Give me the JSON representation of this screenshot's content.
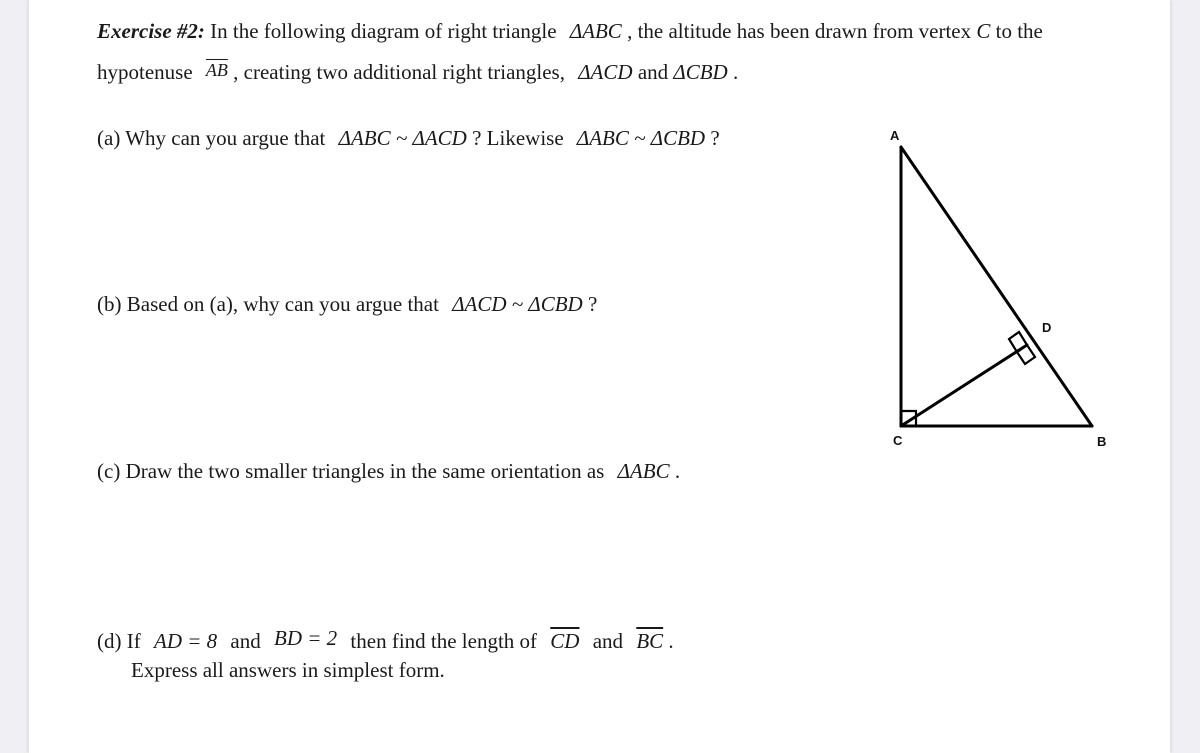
{
  "exercise": {
    "heading": "Exercise #2:",
    "intro_line1": {
      "t1": "In the following diagram of right triangle",
      "tri": "ΔABC",
      "t2": ", the altitude has been drawn from vertex",
      "vertex": "C",
      "t3": "to the"
    },
    "intro_line2": {
      "t1": "hypotenuse",
      "seg": "AB",
      "t2": ", creating two additional right triangles,",
      "tri1": "ΔACD",
      "and": "and",
      "tri2": "ΔCBD",
      "end": "."
    }
  },
  "parts": {
    "a": {
      "label": "(a)",
      "t1": "Why can you argue that",
      "sim1": "ΔABC ~ ΔACD",
      "t2": "? Likewise",
      "sim2": "ΔABC ~ ΔCBD",
      "t3": "?"
    },
    "b": {
      "label": "(b)",
      "t1": "Based on (a), why can you argue that",
      "sim": "ΔACD ~ ΔCBD",
      "t2": "?"
    },
    "c": {
      "label": "(c)",
      "t1": "Draw the two smaller triangles in the same orientation as",
      "tri": "ΔABC",
      "t2": "."
    },
    "d": {
      "label": "(d)",
      "t1": "If",
      "eq1": "AD = 8",
      "and1": "and",
      "eq2": "BD = 2",
      "t2": "then find the length of",
      "seg1": "CD",
      "and2": "and",
      "seg2": "BC",
      "t3": ".",
      "line2": "Express all answers in simplest form."
    }
  },
  "diagram": {
    "vertex_labels": {
      "A": "A",
      "B": "B",
      "C": "C",
      "D": "D"
    },
    "right_angle_marks": [
      "C",
      "D"
    ],
    "segments": [
      "AC",
      "CB",
      "AB",
      "CD"
    ]
  }
}
